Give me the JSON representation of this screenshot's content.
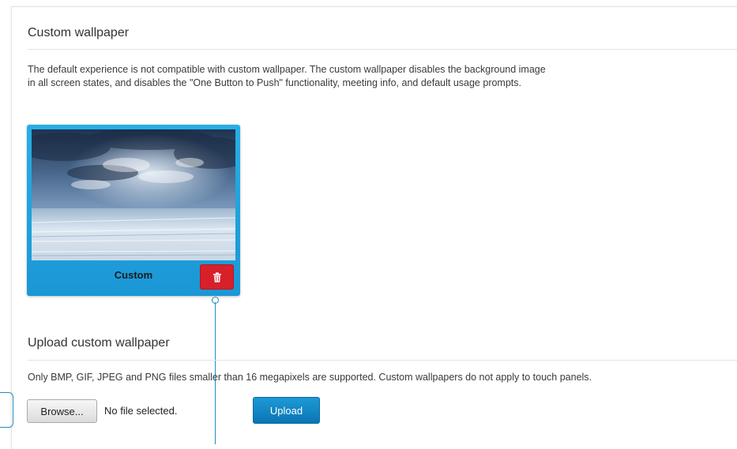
{
  "custom_wallpaper": {
    "title": "Custom wallpaper",
    "description_line1": "The default experience is not compatible with custom wallpaper. The custom wallpaper disables the background image",
    "description_line2": "in all screen states, and disables the \"One Button to Push\" functionality, meeting info, and default usage prompts.",
    "card": {
      "label": "Custom",
      "delete_icon": "trash-icon",
      "color": "#1fa3df",
      "delete_color": "#d8202a"
    }
  },
  "upload": {
    "title": "Upload custom wallpaper",
    "note": "Only BMP, GIF, JPEG and PNG files smaller than 16 megapixels are supported. Custom wallpapers do not apply to touch panels.",
    "browse_label": "Browse...",
    "file_status": "No file selected.",
    "upload_label": "Upload",
    "upload_color": "#1183c5"
  },
  "callout_color": "#1f8fbf"
}
